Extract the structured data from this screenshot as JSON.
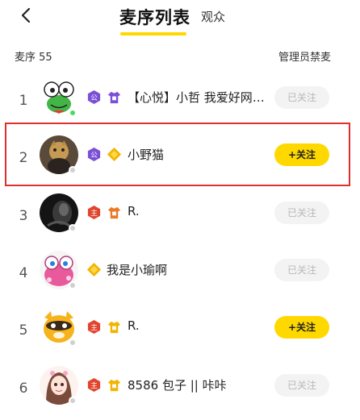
{
  "header": {
    "tab_active": "麦序列表",
    "tab_inactive": "观众"
  },
  "info": {
    "count_label": "麦序",
    "count_value": "55",
    "admin_label": "管理员禁麦"
  },
  "badge_text": {
    "gong": "公",
    "zhu": "主"
  },
  "rows": [
    {
      "index": "1",
      "name": "【心悦】小哲 我爱好网…",
      "button": "已关注",
      "status_color": "#4cd964"
    },
    {
      "index": "2",
      "name": "小野猫",
      "button": "+关注",
      "status_color": "#d0d0d0"
    },
    {
      "index": "3",
      "name": "R.",
      "button": "已关注",
      "status_color": "#d0d0d0"
    },
    {
      "index": "4",
      "name": "我是小瑜啊",
      "button": "已关注",
      "status_color": "#d0d0d0"
    },
    {
      "index": "5",
      "name": "R.",
      "button": "+关注",
      "status_color": "#d0d0d0"
    },
    {
      "index": "6",
      "name": "8586 包子 || 咔咔",
      "button": "已关注",
      "status_color": "#d0d0d0"
    }
  ],
  "colors": {
    "accent": "#ffd800",
    "highlight_border": "#e0302e",
    "gong_badge": "#7b4fd6",
    "zhu_badge": "#e2452f"
  }
}
